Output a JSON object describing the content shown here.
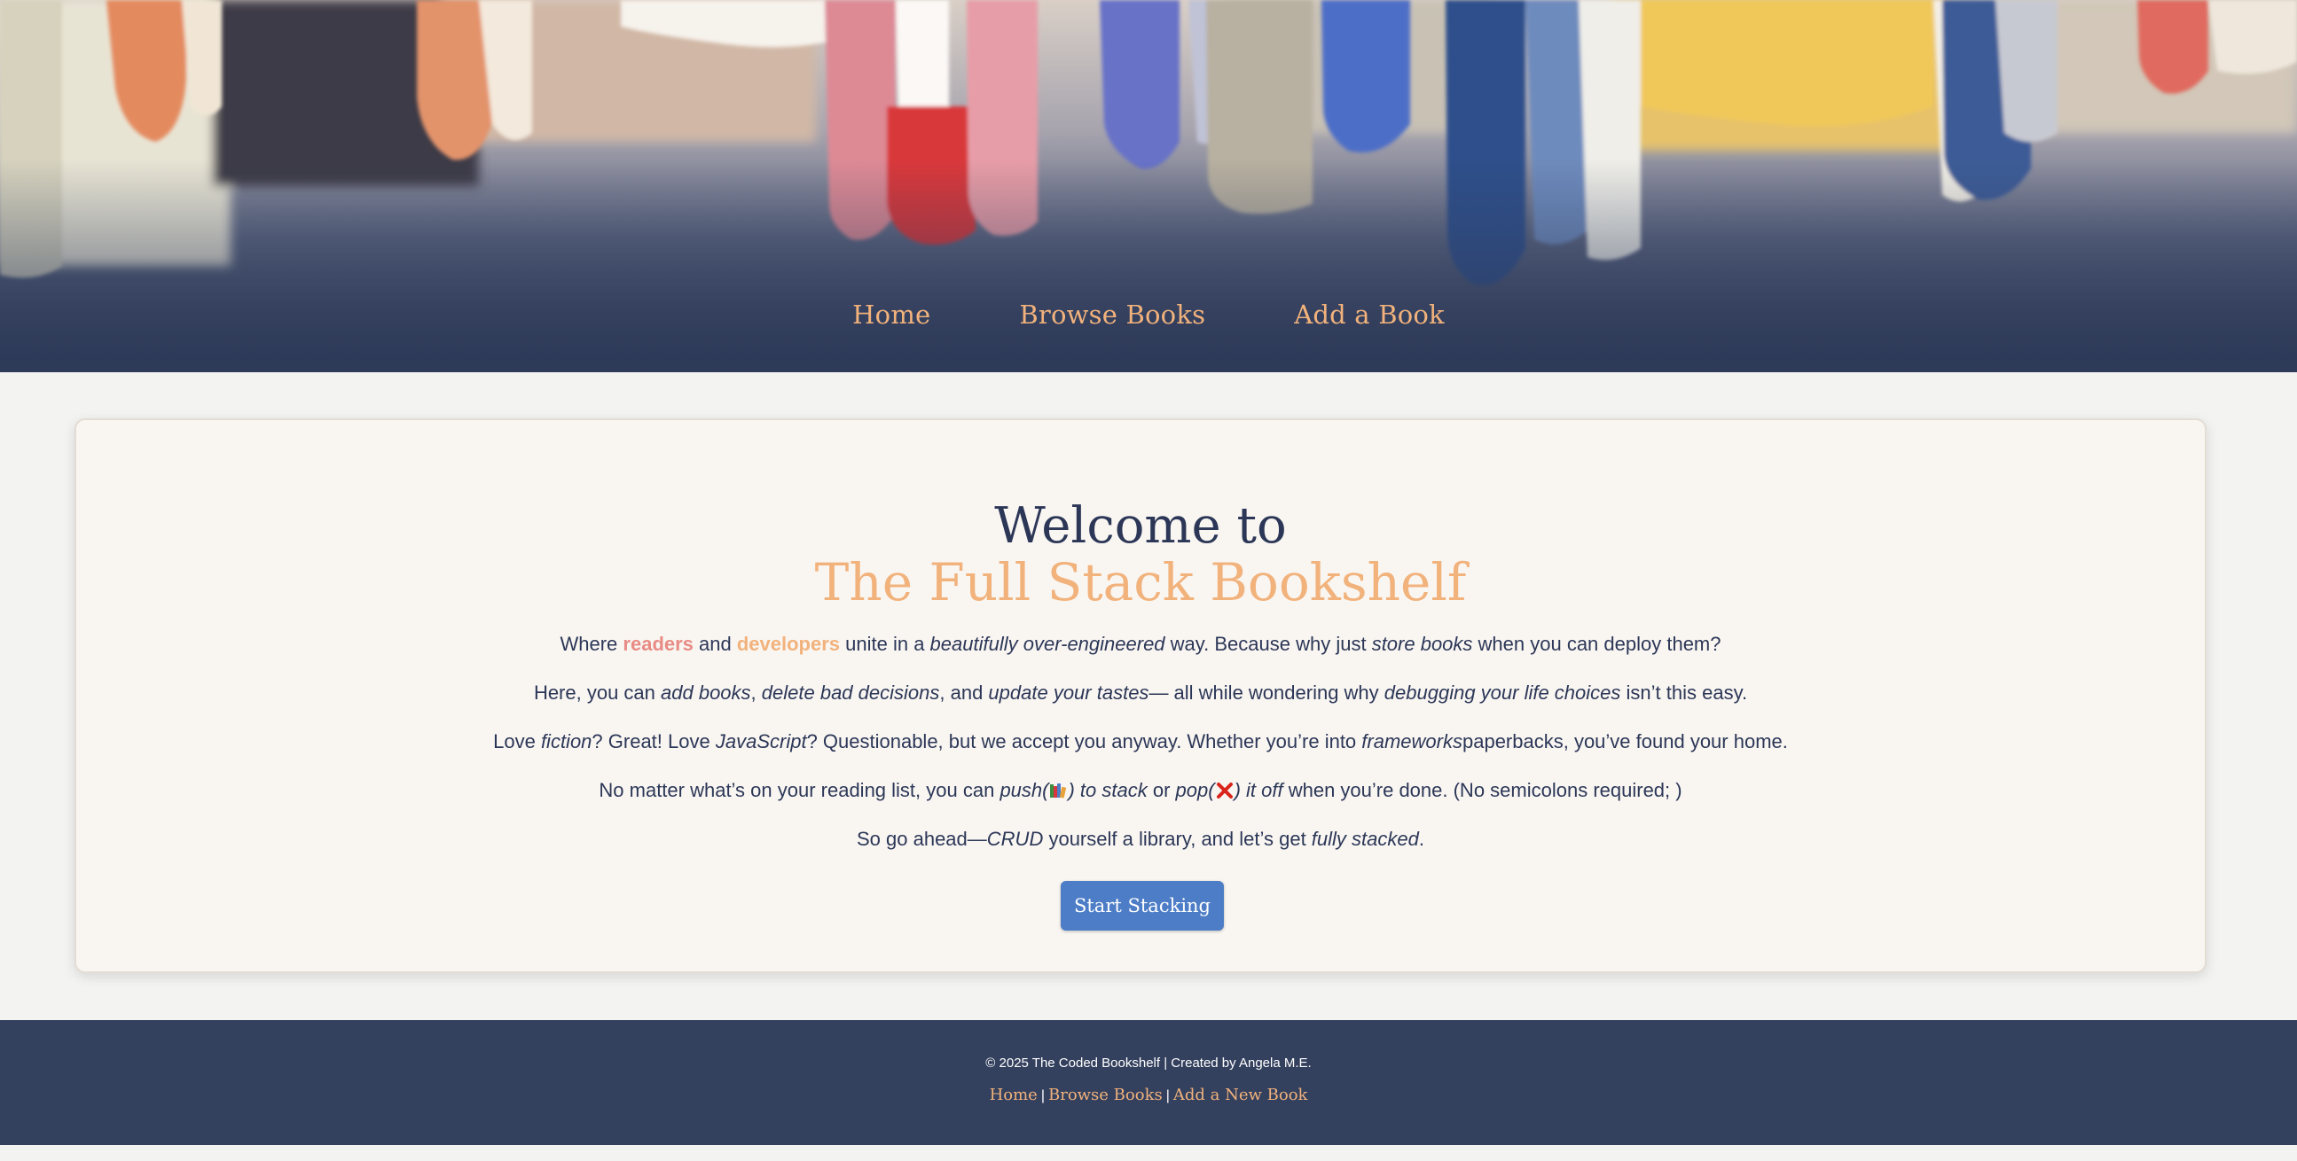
{
  "nav": {
    "items": [
      "Home",
      "Browse Books",
      "Add a Book"
    ]
  },
  "welcome": {
    "heading_line1": "Welcome to",
    "heading_line2": "The Full Stack Bookshelf",
    "p1": {
      "a": "Where ",
      "readers": "readers",
      "b": " and ",
      "developers": "developers",
      "c": " unite in a ",
      "d": "beautifully over-engineered",
      "e": " way. Because why just ",
      "f": "store books",
      "g": " when you can deploy them?"
    },
    "p2": {
      "a": "Here, you can ",
      "b": "add books",
      "c": ", ",
      "d": "delete bad decisions",
      "e": ", and ",
      "f": "update your tastes",
      "g": "— all while wondering why ",
      "h": "debugging your life choices",
      "i": " isn’t this easy."
    },
    "p3": {
      "a": "Love ",
      "b": "fiction",
      "c": "? Great! Love ",
      "d": "JavaScript",
      "e": "? Questionable, but we accept you anyway. Whether you’re into ",
      "f": "frameworks",
      "g": "paperbacks, you’ve found your home."
    },
    "p4": {
      "a": "No matter what’s on your reading list, you can ",
      "b": "push(",
      "c": ") to stack",
      "d": " or ",
      "e": "pop(",
      "f": ") it off",
      "g": " when you’re done. (No semicolons required; )"
    },
    "p5": {
      "a": "So go ahead—",
      "b": "CRUD",
      "c": " yourself a library, and let’s get ",
      "d": "fully stacked",
      "e": "."
    },
    "cta_label": "Start Stacking"
  },
  "footer": {
    "copyright": "© 2025 The Coded Bookshelf | Created by Angela M.E.",
    "links": [
      "Home",
      "Browse Books",
      "Add a New Book"
    ],
    "separator": "|"
  },
  "colors": {
    "navy": "#2c3757",
    "peach": "#f2b27c",
    "coral": "#e88b84",
    "button_blue": "#4d7dc6",
    "footer_bg": "#33405e",
    "card_bg": "#f9f6f2"
  },
  "icons": [
    "books-emoji-icon",
    "red-x-icon"
  ]
}
